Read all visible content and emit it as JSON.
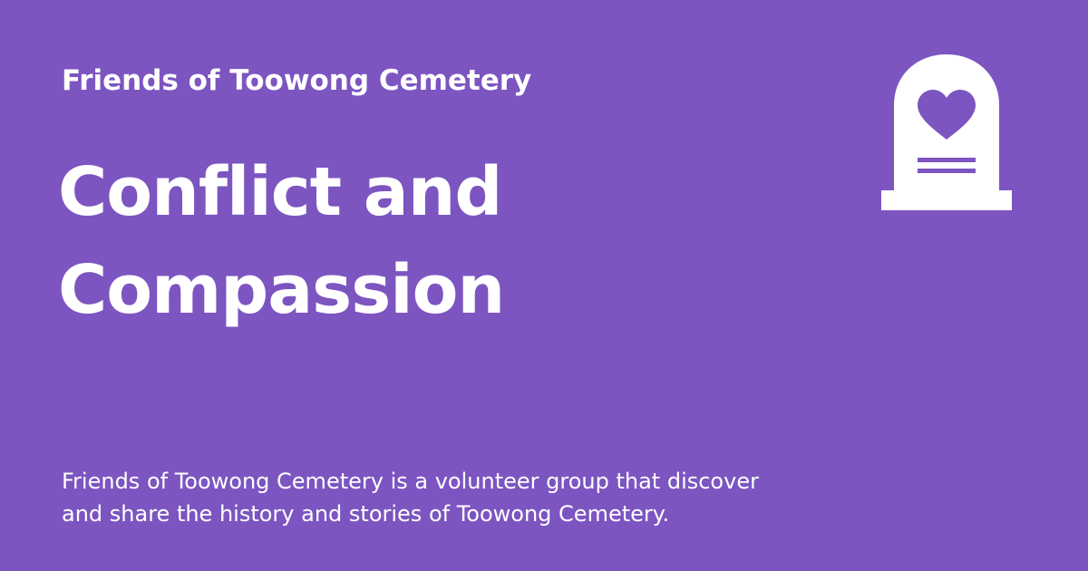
{
  "colors": {
    "background": "#7c55c1",
    "text": "#ffffff",
    "icon_fill": "#ffffff",
    "icon_accent": "#7c55c1"
  },
  "site": {
    "name": "Friends of Toowong Cemetery"
  },
  "title": {
    "line1": "Conflict and",
    "line2": "Compassion"
  },
  "description": {
    "line1": "Friends of Toowong Cemetery is a volunteer group that discover",
    "line2": "and share the history and stories of Toowong Cemetery."
  },
  "icons": {
    "headstone": "headstone-with-heart-icon"
  }
}
